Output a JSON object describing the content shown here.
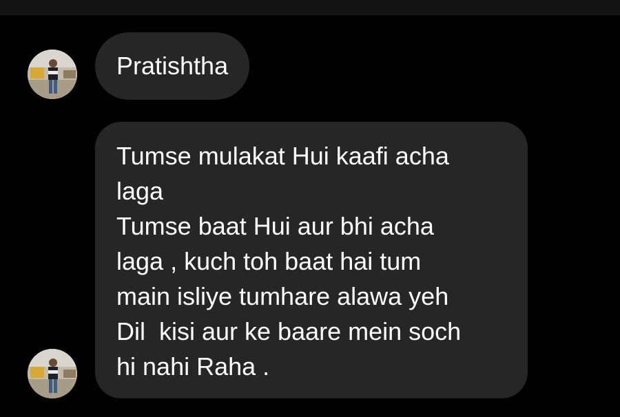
{
  "chat": {
    "first_message": {
      "sender_avatar": "profile-photo",
      "text": "Pratishtha"
    },
    "second_message": {
      "sender_avatar": "profile-photo",
      "lines": [
        "Tumse mulakat Hui kaafi acha",
        "laga",
        "Tumse baat Hui aur bhi acha",
        "laga , kuch toh baat hai tum",
        "main isliye tumhare alawa yeh",
        "Dil  kisi aur ke baare mein soch",
        "hi nahi Raha ."
      ]
    }
  },
  "colors": {
    "background": "#000000",
    "bubble": "#262626",
    "text": "#ffffff",
    "top_strip": "#141414"
  }
}
